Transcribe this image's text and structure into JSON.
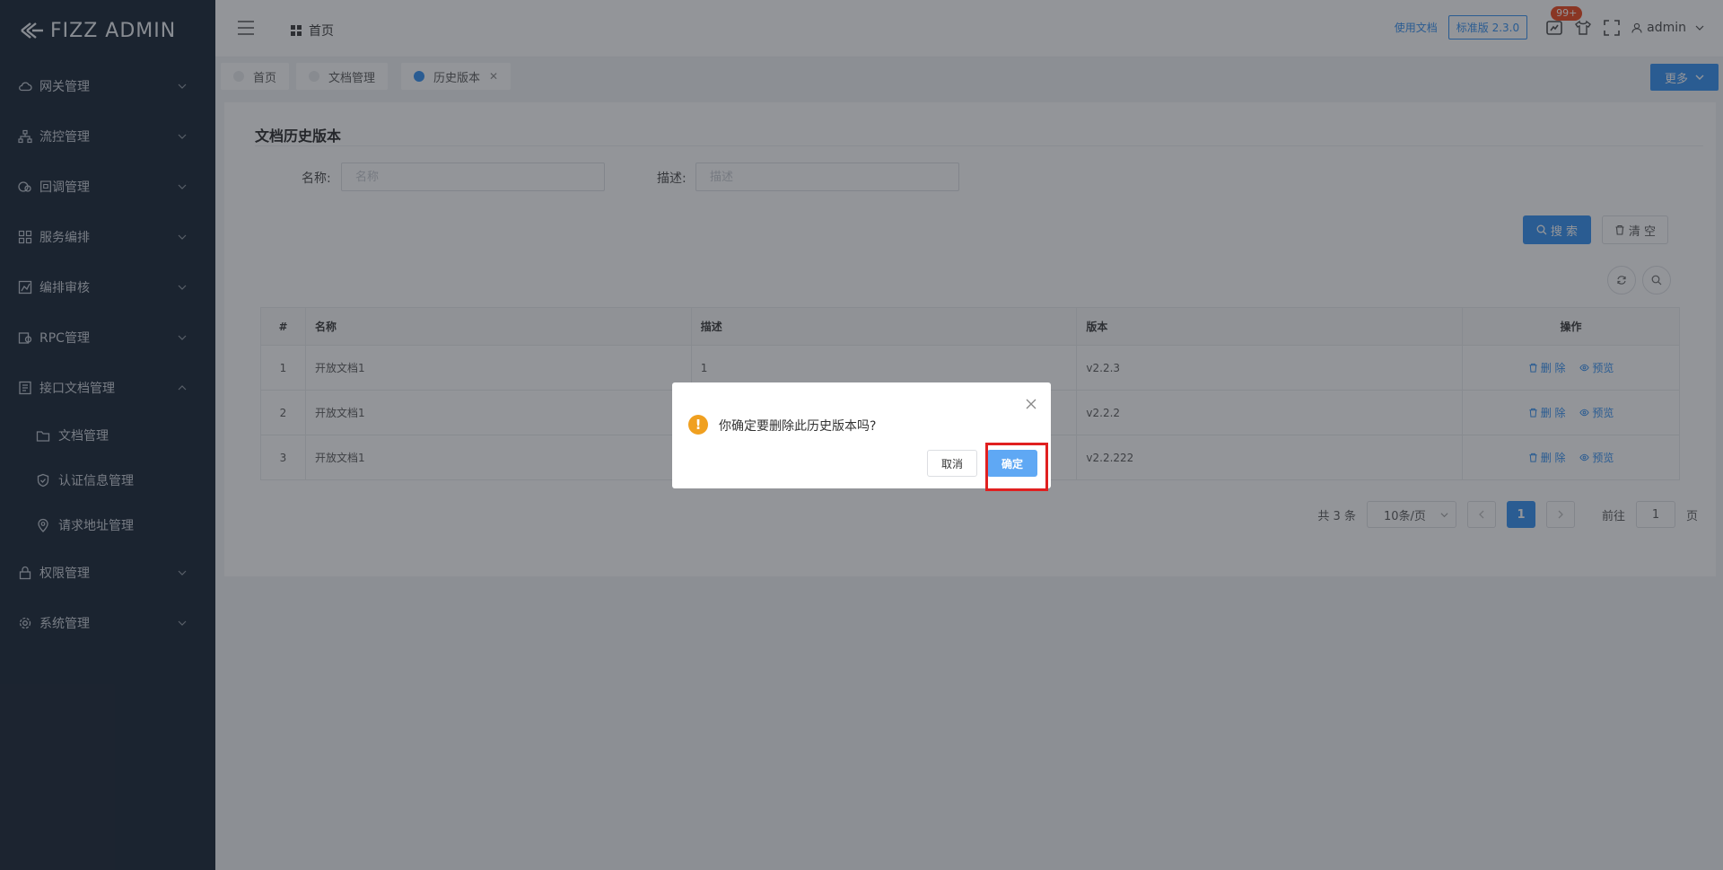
{
  "app": {
    "logo_text": "FIZZ ADMIN"
  },
  "sidebar": {
    "items": [
      {
        "label": "网关管理",
        "icon": "cloud-icon"
      },
      {
        "label": "流控管理",
        "icon": "sitemap-icon"
      },
      {
        "label": "回调管理",
        "icon": "callback-icon"
      },
      {
        "label": "服务编排",
        "icon": "grid-icon"
      },
      {
        "label": "编排审核",
        "icon": "audit-icon"
      },
      {
        "label": "RPC管理",
        "icon": "rpc-icon"
      },
      {
        "label": "接口文档管理",
        "icon": "document-icon",
        "expanded": true,
        "children": [
          {
            "label": "文档管理",
            "icon": "folder-icon"
          },
          {
            "label": "认证信息管理",
            "icon": "shield-icon"
          },
          {
            "label": "请求地址管理",
            "icon": "location-icon"
          }
        ]
      },
      {
        "label": "权限管理",
        "icon": "lock-icon"
      },
      {
        "label": "系统管理",
        "icon": "gear-icon"
      }
    ]
  },
  "header": {
    "breadcrumb_home": "首页",
    "doc_link": "使用文档",
    "version_badge": "标准版 2.3.0",
    "notification_count": "99+",
    "username": "admin"
  },
  "tabs": [
    {
      "label": "首页",
      "active": false
    },
    {
      "label": "文档管理",
      "active": false
    },
    {
      "label": "历史版本",
      "active": true,
      "closable": true
    }
  ],
  "more_button": "更多",
  "page": {
    "title": "文档历史版本",
    "filters": {
      "name_label": "名称:",
      "name_placeholder": "名称",
      "desc_label": "描述:",
      "desc_placeholder": "描述"
    },
    "search_button": "搜 索",
    "clear_button": "清 空"
  },
  "table": {
    "headers": [
      "#",
      "名称",
      "描述",
      "版本",
      "操作"
    ],
    "rows": [
      {
        "idx": "1",
        "name": "开放文档1",
        "desc": "1",
        "version": "v2.2.3"
      },
      {
        "idx": "2",
        "name": "开放文档1",
        "desc": "",
        "version": "v2.2.2"
      },
      {
        "idx": "3",
        "name": "开放文档1",
        "desc": "",
        "version": "v2.2.222"
      }
    ],
    "delete_label": "删 除",
    "preview_label": "预览"
  },
  "pagination": {
    "total_text": "共 3 条",
    "page_size": "10条/页",
    "current_page": "1",
    "goto_prefix": "前往",
    "goto_value": "1",
    "goto_suffix": "页"
  },
  "dialog": {
    "message": "你确定要删除此历史版本吗?",
    "cancel_label": "取消",
    "ok_label": "确定"
  },
  "colors": {
    "sidebar_bg": "#0f1c2c",
    "primary": "#2d8cf0",
    "warning": "#f0a020",
    "highlight": "#e02020"
  }
}
